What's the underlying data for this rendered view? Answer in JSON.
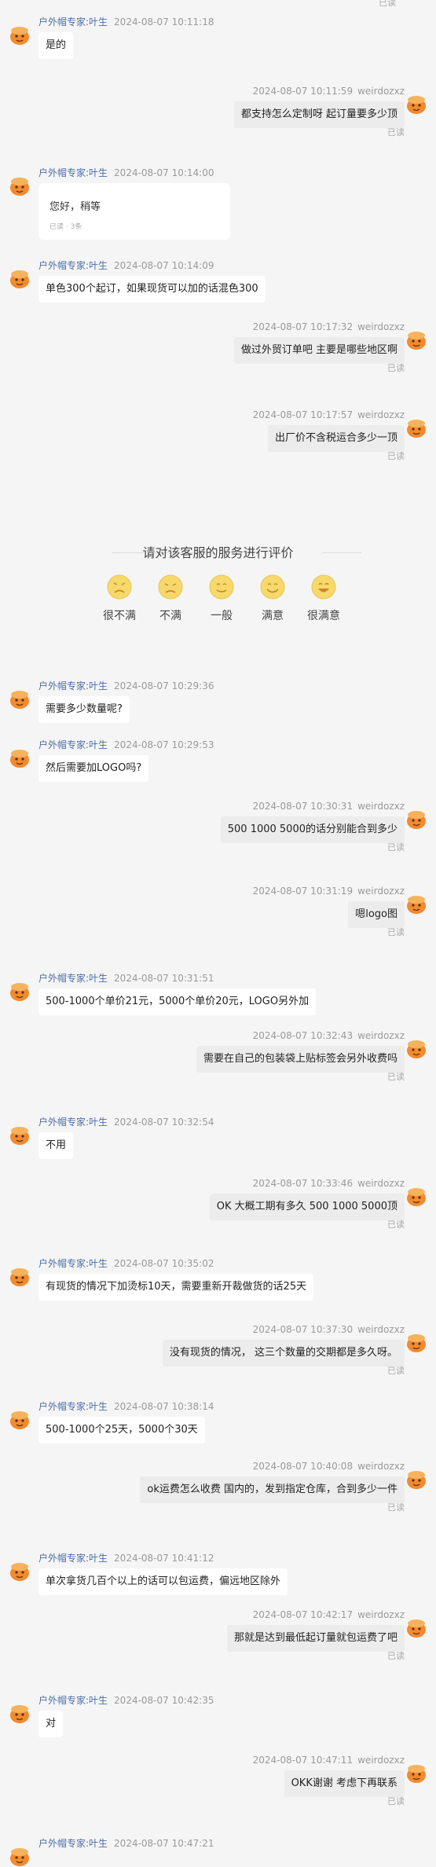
{
  "colors": {
    "background": "#f5f5f5",
    "agent_name": "#4c6ea8",
    "bubble_left": "#ffffff",
    "bubble_right": "#ececec",
    "meta_text": "#9a9a9a",
    "avatar_orange": "#f28a2e",
    "face_yellow": "#f7d96b"
  },
  "agent_name": "户外帽专家:叶生",
  "user_name": "weirdozxz",
  "read_label": "已读",
  "rating": {
    "title": "请对该客服的服务进行评价",
    "options": [
      {
        "label": "很不满",
        "icon": "very-unsatisfied-face-icon"
      },
      {
        "label": "不满",
        "icon": "unsatisfied-face-icon"
      },
      {
        "label": "一般",
        "icon": "neutral-face-icon"
      },
      {
        "label": "满意",
        "icon": "satisfied-face-icon"
      },
      {
        "label": "很满意",
        "icon": "very-satisfied-face-icon"
      }
    ]
  },
  "card": {
    "text": "您好，稍等",
    "subtext": "已读 · 3条"
  },
  "messages": [
    {
      "side": "left",
      "time": "2024-08-07 10:11:18",
      "text": "是的"
    },
    {
      "side": "right",
      "time": "2024-08-07 10:11:59",
      "text": "都支持怎么定制呀 起订量要多少顶",
      "read": true
    },
    {
      "side": "left",
      "time": "2024-08-07 10:14:00",
      "card": true
    },
    {
      "side": "left",
      "time": "2024-08-07 10:14:09",
      "text": "单色300个起订，如果现货可以加的话混色300"
    },
    {
      "side": "right",
      "time": "2024-08-07 10:17:32",
      "text": "做过外贸订单吧 主要是哪些地区啊",
      "read": true
    },
    {
      "side": "right",
      "time": "2024-08-07 10:17:57",
      "text": "出厂价不含税运合多少一顶",
      "read": true
    },
    {
      "side": "left",
      "time": "2024-08-07 10:29:36",
      "text": "需要多少数量呢?"
    },
    {
      "side": "left",
      "time": "2024-08-07 10:29:53",
      "text": "然后需要加LOGO吗?"
    },
    {
      "side": "right",
      "time": "2024-08-07 10:30:31",
      "text": "500 1000 5000的话分别能合到多少",
      "read": true
    },
    {
      "side": "right",
      "time": "2024-08-07 10:31:19",
      "text": "嗯logo图",
      "read": true
    },
    {
      "side": "left",
      "time": "2024-08-07 10:31:51",
      "text": "500-1000个单价21元，5000个单价20元，LOGO另外加"
    },
    {
      "side": "right",
      "time": "2024-08-07 10:32:43",
      "text": "需要在自己的包装袋上贴标签会另外收费吗",
      "read": true
    },
    {
      "side": "left",
      "time": "2024-08-07 10:32:54",
      "text": "不用"
    },
    {
      "side": "right",
      "time": "2024-08-07 10:33:46",
      "text": "OK 大概工期有多久 500 1000 5000顶",
      "read": true
    },
    {
      "side": "left",
      "time": "2024-08-07 10:35:02",
      "text": "有现货的情况下加烫标10天，需要重新开裁做货的话25天"
    },
    {
      "side": "right",
      "time": "2024-08-07 10:37:30",
      "text": "没有现货的情况， 这三个数量的交期都是多久呀。",
      "read": true
    },
    {
      "side": "left",
      "time": "2024-08-07 10:38:14",
      "text": "500-1000个25天，5000个30天"
    },
    {
      "side": "right",
      "time": "2024-08-07 10:40:08",
      "text": "ok运费怎么收费 国内的，发到指定仓库，合到多少一件",
      "read": true
    },
    {
      "side": "left",
      "time": "2024-08-07 10:41:12",
      "text": "单次拿货几百个以上的话可以包运费，偏远地区除外"
    },
    {
      "side": "right",
      "time": "2024-08-07 10:42:17",
      "text": "那就是达到最低起订量就包运费了吧",
      "read": true
    },
    {
      "side": "left",
      "time": "2024-08-07 10:42:35",
      "text": "对"
    },
    {
      "side": "right",
      "time": "2024-08-07 10:47:11",
      "text": "OKK谢谢 考虑下再联系",
      "read": true
    },
    {
      "side": "left",
      "time": "2024-08-07 10:47:21",
      "text": ""
    }
  ]
}
